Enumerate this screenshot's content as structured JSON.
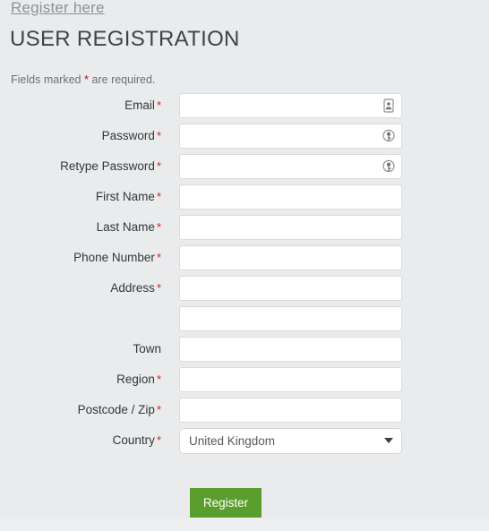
{
  "breadcrumb": {
    "label": "Register here"
  },
  "header": {
    "title": "USER REGISTRATION"
  },
  "notice": {
    "prefix": "Fields marked",
    "star": "*",
    "suffix": "are required."
  },
  "colors": {
    "page_background": "#e9ebec",
    "footer_band": "#eceeef",
    "required_star": "#e02020",
    "button_green": "#5b9e2d",
    "input_border": "#d9dcdd",
    "label_text": "#33383b",
    "heading_text": "#3f4447",
    "breadcrumb_text": "#8e9396"
  },
  "form": {
    "fields": [
      {
        "label": "Email",
        "required": true,
        "type": "text",
        "value": "",
        "placeholder": "",
        "icon": "contact-card-autofill-icon"
      },
      {
        "label": "Password",
        "required": true,
        "type": "password",
        "value": "",
        "placeholder": "",
        "icon": "key-autofill-icon"
      },
      {
        "label": "Retype Password",
        "required": true,
        "type": "password",
        "value": "",
        "placeholder": "",
        "icon": "key-autofill-icon"
      },
      {
        "label": "First Name",
        "required": true,
        "type": "text",
        "value": "",
        "placeholder": "",
        "icon": ""
      },
      {
        "label": "Last Name",
        "required": true,
        "type": "text",
        "value": "",
        "placeholder": "",
        "icon": ""
      },
      {
        "label": "Phone Number",
        "required": true,
        "type": "text",
        "value": "",
        "placeholder": "",
        "icon": ""
      },
      {
        "label": "Address",
        "required": true,
        "type": "text",
        "value": "",
        "placeholder": "",
        "icon": ""
      },
      {
        "label": "",
        "required": false,
        "type": "text",
        "value": "",
        "placeholder": "",
        "icon": ""
      },
      {
        "label": "Town",
        "required": false,
        "type": "text",
        "value": "",
        "placeholder": "",
        "icon": ""
      },
      {
        "label": "Region",
        "required": true,
        "type": "text",
        "value": "",
        "placeholder": "",
        "icon": ""
      },
      {
        "label": "Postcode / Zip",
        "required": true,
        "type": "text",
        "value": "",
        "placeholder": "",
        "icon": ""
      }
    ],
    "country": {
      "label": "Country",
      "required": true,
      "selected": "United Kingdom"
    },
    "submit": {
      "label": "Register"
    }
  }
}
